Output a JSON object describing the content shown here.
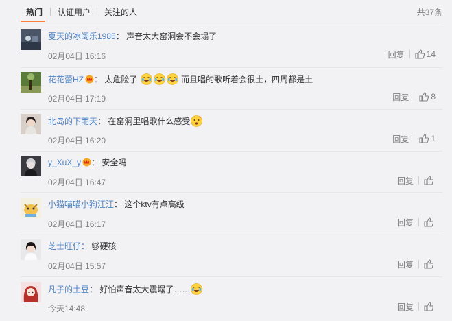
{
  "tabs": [
    {
      "label": "热门"
    },
    {
      "label": "认证用户"
    },
    {
      "label": "关注的人"
    }
  ],
  "total": "共37条",
  "comments": [
    {
      "user": "夏天的冰阔乐1985",
      "text": "声音太大窑洞会不会塌了",
      "time": "02月04日 16:16",
      "reply": "回复",
      "likes": "14",
      "avatar": "avatar-dark-photo"
    },
    {
      "user": "花花蕾HZ",
      "text1": "太危险了",
      "text2": "而且唱的歌听着会很土，四周都是土",
      "time": "02月04日 17:19",
      "reply": "回复",
      "likes": "8",
      "avatar": "avatar-plant-photo",
      "badge": "vip-crown-icon",
      "emoji": "crying-laughing-emoji"
    },
    {
      "user": "北岛的下雨天",
      "text": "在窑洞里唱歌什么感受",
      "time": "02月04日 16:20",
      "reply": "回复",
      "likes": "1",
      "avatar": "avatar-girl-photo",
      "emoji": "puzzled-emoji"
    },
    {
      "user": "y_XuX_y",
      "text": "安全吗",
      "time": "02月04日 16:47",
      "reply": "回复",
      "likes": "",
      "avatar": "avatar-anime-photo",
      "badge": "vip-crown-icon"
    },
    {
      "user": "小猫喵喵小狗汪汪",
      "text": "这个ktv有点高级",
      "time": "02月04日 16:17",
      "reply": "回复",
      "likes": "",
      "avatar": "avatar-cartoon-photo"
    },
    {
      "user": "芝士旺仔：",
      "text": "够硬核",
      "time": "02月04日 15:57",
      "reply": "回复",
      "likes": "",
      "avatar": "avatar-girl2-photo"
    },
    {
      "user": "凡子的土豆",
      "text": "好怕声音太大震塌了……",
      "time": "今天14:48",
      "reply": "回复",
      "likes": "",
      "avatar": "avatar-redhair-photo",
      "emoji": "crying-laughing-emoji"
    }
  ]
}
